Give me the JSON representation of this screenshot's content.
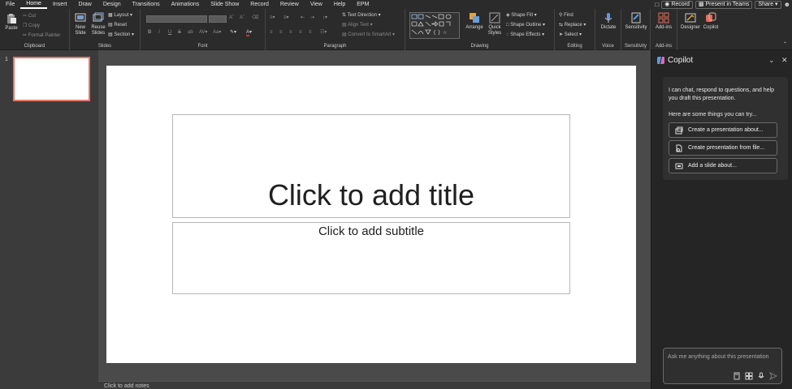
{
  "menu": {
    "tabs": [
      "File",
      "Home",
      "Insert",
      "Draw",
      "Design",
      "Transitions",
      "Animations",
      "Slide Show",
      "Record",
      "Review",
      "View",
      "Help",
      "EPM"
    ],
    "active_tab": "Home",
    "record_label": "Record",
    "present_label": "Present in Teams",
    "share_label": "Share"
  },
  "ribbon": {
    "clipboard": {
      "label": "Clipboard",
      "paste": "Paste",
      "cut": "Cut",
      "copy": "Copy",
      "format_painter": "Format Painter"
    },
    "slides": {
      "label": "Slides",
      "new_slide": "New Slide",
      "reuse_slides": "Reuse Slides",
      "layout": "Layout",
      "reset": "Reset",
      "section": "Section"
    },
    "font": {
      "label": "Font",
      "bold": "B",
      "italic": "I",
      "underline": "U",
      "strike": "S"
    },
    "paragraph": {
      "label": "Paragraph",
      "text_direction": "Text Direction",
      "align_text": "Align Text",
      "convert_smartart": "Convert to SmartArt"
    },
    "drawing": {
      "label": "Drawing",
      "arrange": "Arrange",
      "quick_styles": "Quick Styles",
      "shape_fill": "Shape Fill",
      "shape_outline": "Shape Outline",
      "shape_effects": "Shape Effects"
    },
    "editing": {
      "label": "Editing",
      "find": "Find",
      "replace": "Replace",
      "select": "Select"
    },
    "voice": {
      "label": "Voice",
      "dictate": "Dictate"
    },
    "sensitivity": {
      "label": "Sensitivity",
      "button": "Sensitivity"
    },
    "addins": {
      "label": "Add-ins",
      "button": "Add-ins"
    },
    "designer": "Designer",
    "copilot": "Copilot"
  },
  "slides_pane": {
    "slide_number": "1"
  },
  "slide": {
    "title_placeholder": "Click to add title",
    "subtitle_placeholder": "Click to add subtitle"
  },
  "notes_placeholder": "Click to add notes",
  "copilot": {
    "title": "Copilot",
    "intro": "I can chat, respond to questions, and help you draft this presentation.",
    "suggest_heading": "Here are some things you can try...",
    "suggestions": [
      "Create a presentation about...",
      "Create presentation from file...",
      "Add a slide about..."
    ],
    "input_placeholder": "Ask me anything about this presentation"
  },
  "colors": {
    "thumb_selected_border": "#e27a6b",
    "ribbon_bg": "#2b2b2b",
    "pane_bg": "#252525"
  }
}
